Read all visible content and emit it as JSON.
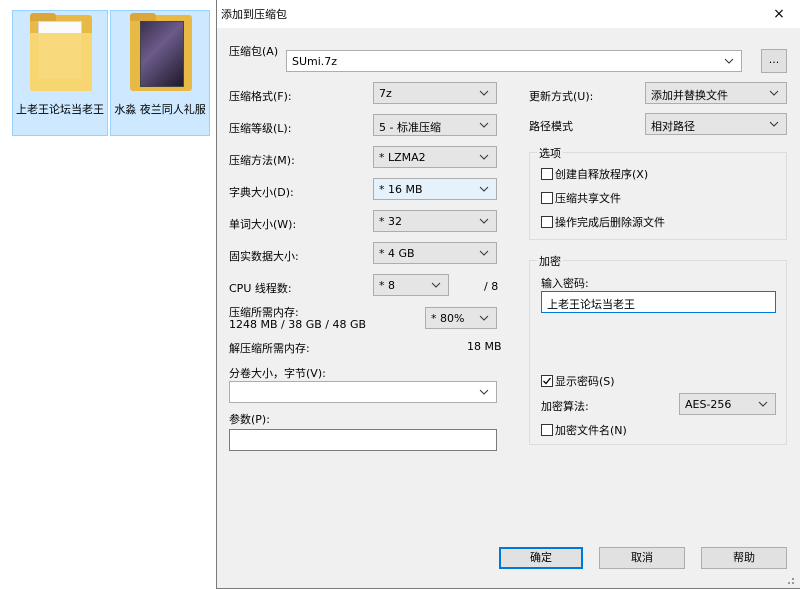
{
  "desktop": {
    "items": [
      {
        "label": "上老王论坛当老王"
      },
      {
        "label": "水淼 夜兰同人礼服"
      }
    ]
  },
  "dialog": {
    "title": "添加到压缩包",
    "close": "×",
    "archive_label": "压缩包(A)",
    "archive_value": "SUmi.7z",
    "browse": "...",
    "format_label": "压缩格式(F):",
    "format_value": "7z",
    "level_label": "压缩等级(L):",
    "level_value": "5 - 标准压缩",
    "method_label": "压缩方法(M):",
    "method_value": "* LZMA2",
    "dict_label": "字典大小(D):",
    "dict_value": "* 16 MB",
    "word_label": "单词大小(W):",
    "word_value": "* 32",
    "solid_label": "固实数据大小:",
    "solid_value": "* 4 GB",
    "threads_label": "CPU 线程数:",
    "threads_value": "* 8",
    "threads_max": "/ 8",
    "mem_label": "压缩所需内存:",
    "mem_value": "1248 MB / 38 GB / 48 GB",
    "mem_pct": "* 80%",
    "dmem_label": "解压缩所需内存:",
    "dmem_value": "18 MB",
    "split_label": "分卷大小，字节(V):",
    "split_value": "",
    "params_label": "参数(P):",
    "params_value": "",
    "update_label": "更新方式(U):",
    "update_value": "添加并替换文件",
    "path_label": "路径模式",
    "path_value": "相对路径",
    "options_title": "选项",
    "opt_sfx": "创建自释放程序(X)",
    "opt_shared": "压缩共享文件",
    "opt_delete": "操作完成后删除源文件",
    "encrypt_title": "加密",
    "pwd_label": "输入密码:",
    "pwd_value": "上老王论坛当老王",
    "show_pwd": "显示密码(S)",
    "enc_method_label": "加密算法:",
    "enc_method_value": "AES-256",
    "enc_names": "加密文件名(N)",
    "ok": "确定",
    "cancel": "取消",
    "help": "帮助"
  }
}
